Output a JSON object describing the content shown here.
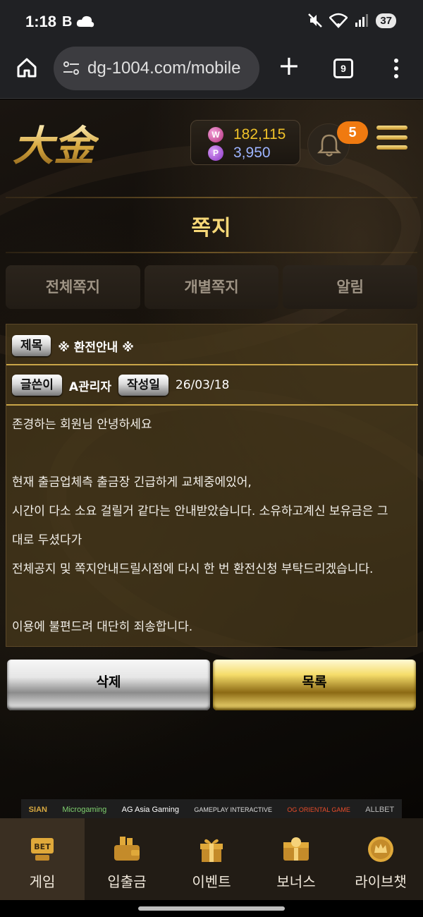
{
  "statusbar": {
    "time": "1:18",
    "battery": "37",
    "icons": [
      "b-icon",
      "cloud-icon",
      "mute-icon",
      "wifi-icon",
      "signal-icon"
    ]
  },
  "browser": {
    "url": "dg-1004.com/mobile",
    "tab_count": "9"
  },
  "header": {
    "logo_text": "大金",
    "balance_w_badge": "W",
    "balance_w": "182,115",
    "balance_p_badge": "P",
    "balance_p": "3,950",
    "notification_count": "5"
  },
  "page": {
    "title": "쪽지"
  },
  "tabs": [
    {
      "label": "전체쪽지"
    },
    {
      "label": "개별쪽지"
    },
    {
      "label": "알림"
    }
  ],
  "message": {
    "subject_label": "제목",
    "subject": "※ 환전안내 ※",
    "author_label": "글쓴이",
    "author": "A관리자",
    "date_label": "작성일",
    "date": "26/03/18",
    "body": [
      "존경하는 회원님 안녕하세요",
      "",
      "현재 출금업체측 출금장 긴급하게 교체중에있어,",
      "시간이 다소 소요 걸릴거 같다는 안내받았습니다. 소유하고계신 보유금은 그",
      "대로 두셨다가",
      "전체공지 및 쪽지안내드릴시점에 다시 한 번 환전신청 부탁드리겠습니다.",
      "",
      "이용에 불편드려 대단히 죄송합니다."
    ]
  },
  "buttons": {
    "delete": "삭제",
    "list": "목록"
  },
  "providers": [
    "SIAN",
    "Microgaming",
    "AG Asia Gaming",
    "GAMEPLAY INTERACTIVE",
    "OG ORIENTAL GAME",
    "ALLBET"
  ],
  "nav": [
    {
      "label": "게임",
      "icon": "bet-icon"
    },
    {
      "label": "입출금",
      "icon": "wallet-icon"
    },
    {
      "label": "이벤트",
      "icon": "gift-icon"
    },
    {
      "label": "보너스",
      "icon": "bonus-box-icon"
    },
    {
      "label": "라이브챗",
      "icon": "crown-chat-icon"
    }
  ],
  "colors": {
    "gold": "#f0c229",
    "points_blue": "#9db4ff",
    "badge_orange": "#f07a10",
    "panel_brown": "#4a3a1c"
  }
}
